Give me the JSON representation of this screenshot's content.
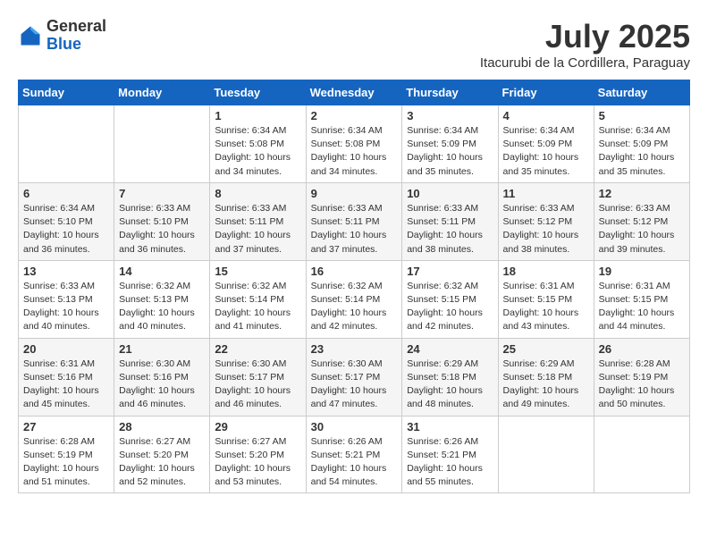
{
  "header": {
    "logo_general": "General",
    "logo_blue": "Blue",
    "month_year": "July 2025",
    "location": "Itacurubi de la Cordillera, Paraguay"
  },
  "calendar": {
    "days_of_week": [
      "Sunday",
      "Monday",
      "Tuesday",
      "Wednesday",
      "Thursday",
      "Friday",
      "Saturday"
    ],
    "weeks": [
      [
        {
          "day": "",
          "info": ""
        },
        {
          "day": "",
          "info": ""
        },
        {
          "day": "1",
          "info": "Sunrise: 6:34 AM\nSunset: 5:08 PM\nDaylight: 10 hours and 34 minutes."
        },
        {
          "day": "2",
          "info": "Sunrise: 6:34 AM\nSunset: 5:08 PM\nDaylight: 10 hours and 34 minutes."
        },
        {
          "day": "3",
          "info": "Sunrise: 6:34 AM\nSunset: 5:09 PM\nDaylight: 10 hours and 35 minutes."
        },
        {
          "day": "4",
          "info": "Sunrise: 6:34 AM\nSunset: 5:09 PM\nDaylight: 10 hours and 35 minutes."
        },
        {
          "day": "5",
          "info": "Sunrise: 6:34 AM\nSunset: 5:09 PM\nDaylight: 10 hours and 35 minutes."
        }
      ],
      [
        {
          "day": "6",
          "info": "Sunrise: 6:34 AM\nSunset: 5:10 PM\nDaylight: 10 hours and 36 minutes."
        },
        {
          "day": "7",
          "info": "Sunrise: 6:33 AM\nSunset: 5:10 PM\nDaylight: 10 hours and 36 minutes."
        },
        {
          "day": "8",
          "info": "Sunrise: 6:33 AM\nSunset: 5:11 PM\nDaylight: 10 hours and 37 minutes."
        },
        {
          "day": "9",
          "info": "Sunrise: 6:33 AM\nSunset: 5:11 PM\nDaylight: 10 hours and 37 minutes."
        },
        {
          "day": "10",
          "info": "Sunrise: 6:33 AM\nSunset: 5:11 PM\nDaylight: 10 hours and 38 minutes."
        },
        {
          "day": "11",
          "info": "Sunrise: 6:33 AM\nSunset: 5:12 PM\nDaylight: 10 hours and 38 minutes."
        },
        {
          "day": "12",
          "info": "Sunrise: 6:33 AM\nSunset: 5:12 PM\nDaylight: 10 hours and 39 minutes."
        }
      ],
      [
        {
          "day": "13",
          "info": "Sunrise: 6:33 AM\nSunset: 5:13 PM\nDaylight: 10 hours and 40 minutes."
        },
        {
          "day": "14",
          "info": "Sunrise: 6:32 AM\nSunset: 5:13 PM\nDaylight: 10 hours and 40 minutes."
        },
        {
          "day": "15",
          "info": "Sunrise: 6:32 AM\nSunset: 5:14 PM\nDaylight: 10 hours and 41 minutes."
        },
        {
          "day": "16",
          "info": "Sunrise: 6:32 AM\nSunset: 5:14 PM\nDaylight: 10 hours and 42 minutes."
        },
        {
          "day": "17",
          "info": "Sunrise: 6:32 AM\nSunset: 5:15 PM\nDaylight: 10 hours and 42 minutes."
        },
        {
          "day": "18",
          "info": "Sunrise: 6:31 AM\nSunset: 5:15 PM\nDaylight: 10 hours and 43 minutes."
        },
        {
          "day": "19",
          "info": "Sunrise: 6:31 AM\nSunset: 5:15 PM\nDaylight: 10 hours and 44 minutes."
        }
      ],
      [
        {
          "day": "20",
          "info": "Sunrise: 6:31 AM\nSunset: 5:16 PM\nDaylight: 10 hours and 45 minutes."
        },
        {
          "day": "21",
          "info": "Sunrise: 6:30 AM\nSunset: 5:16 PM\nDaylight: 10 hours and 46 minutes."
        },
        {
          "day": "22",
          "info": "Sunrise: 6:30 AM\nSunset: 5:17 PM\nDaylight: 10 hours and 46 minutes."
        },
        {
          "day": "23",
          "info": "Sunrise: 6:30 AM\nSunset: 5:17 PM\nDaylight: 10 hours and 47 minutes."
        },
        {
          "day": "24",
          "info": "Sunrise: 6:29 AM\nSunset: 5:18 PM\nDaylight: 10 hours and 48 minutes."
        },
        {
          "day": "25",
          "info": "Sunrise: 6:29 AM\nSunset: 5:18 PM\nDaylight: 10 hours and 49 minutes."
        },
        {
          "day": "26",
          "info": "Sunrise: 6:28 AM\nSunset: 5:19 PM\nDaylight: 10 hours and 50 minutes."
        }
      ],
      [
        {
          "day": "27",
          "info": "Sunrise: 6:28 AM\nSunset: 5:19 PM\nDaylight: 10 hours and 51 minutes."
        },
        {
          "day": "28",
          "info": "Sunrise: 6:27 AM\nSunset: 5:20 PM\nDaylight: 10 hours and 52 minutes."
        },
        {
          "day": "29",
          "info": "Sunrise: 6:27 AM\nSunset: 5:20 PM\nDaylight: 10 hours and 53 minutes."
        },
        {
          "day": "30",
          "info": "Sunrise: 6:26 AM\nSunset: 5:21 PM\nDaylight: 10 hours and 54 minutes."
        },
        {
          "day": "31",
          "info": "Sunrise: 6:26 AM\nSunset: 5:21 PM\nDaylight: 10 hours and 55 minutes."
        },
        {
          "day": "",
          "info": ""
        },
        {
          "day": "",
          "info": ""
        }
      ]
    ]
  }
}
